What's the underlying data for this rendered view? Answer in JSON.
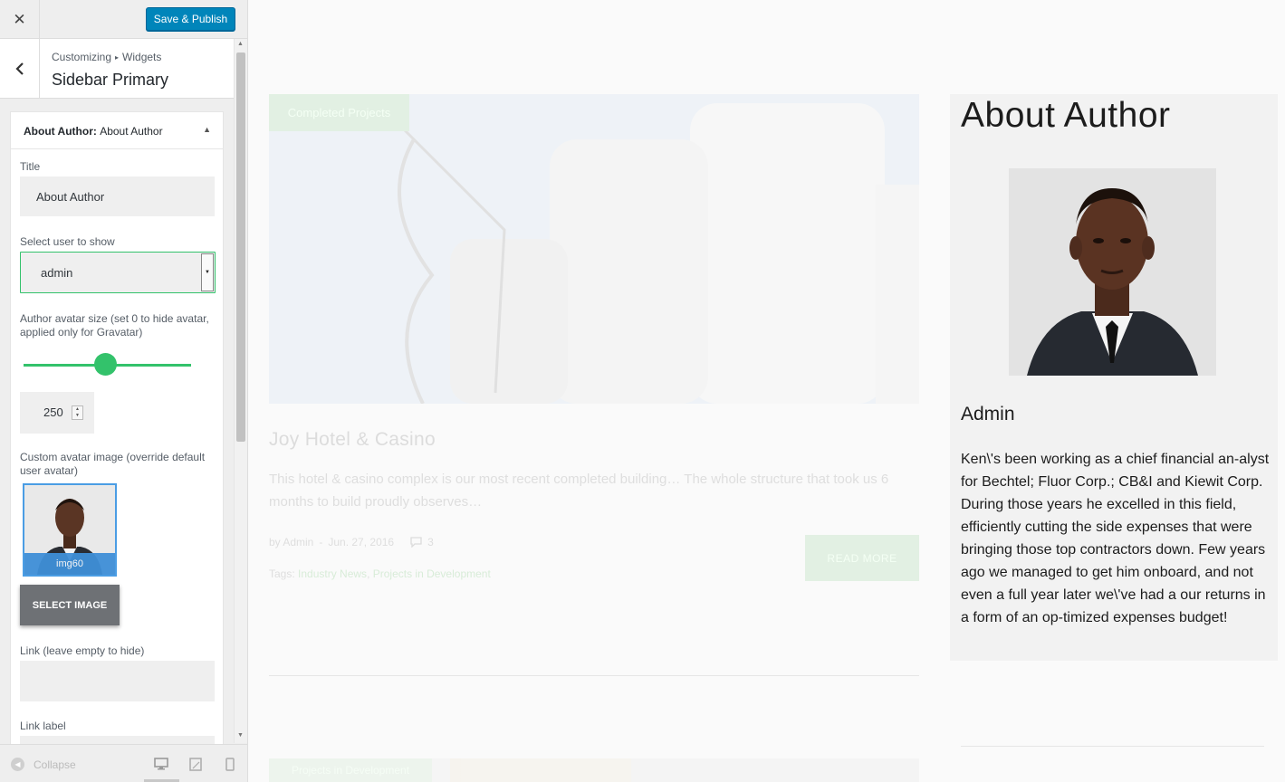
{
  "customizer": {
    "close_icon": "close-icon",
    "publish_label": "Save & Publish",
    "breadcrumb": {
      "root": "Customizing",
      "current": "Widgets"
    },
    "section_title": "Sidebar Primary",
    "widget": {
      "title_prefix": "About Author:",
      "title_name": "About Author",
      "fields": {
        "title_label": "Title",
        "title_value": "About Author",
        "user_label": "Select user to show",
        "user_value": "admin",
        "avatar_size_label": "Author avatar size (set 0 to hide avatar, applied only for Gravatar)",
        "avatar_size_value": "250",
        "avatar_size_slider_fraction": 0.49,
        "custom_avatar_label": "Custom avatar image (override default user avatar)",
        "custom_avatar_filename": "img60",
        "select_image_label": "SELECT IMAGE",
        "link_label": "Link (leave empty to hide)",
        "link_value": "",
        "link_text_label": "Link label"
      }
    },
    "footer": {
      "collapse_label": "Collapse",
      "devices": [
        "desktop-icon",
        "tablet-icon",
        "mobile-icon"
      ],
      "active_device": "desktop"
    },
    "colors": {
      "accent": "#33c26b",
      "publish": "#0085ba"
    }
  },
  "preview": {
    "post": {
      "badge": "Completed Projects",
      "title": "Joy Hotel & Casino",
      "excerpt": "This hotel & casino complex is our most recent completed building… The whole structure that took us 6 months to build proudly observes…",
      "author": "by Admin",
      "date": "Jun. 27, 2016",
      "comments": "3",
      "tags_label": "Tags:",
      "tags": [
        "Industry News",
        "Projects in Development"
      ],
      "read_more": "READ MORE"
    },
    "next_post_badge": "Projects in Development",
    "about": {
      "title": "About Author",
      "name": "Admin",
      "bio": "Ken\\'s been working as a chief financial an-alyst for Bechtel; Fluor Corp.; CB&I and Kiewit Corp. During those years he excelled in this field, efficiently cutting the side expenses that were bringing those top contractors down. Few years ago we managed to get him onboard, and not even a full year later we\\'ve had a our returns in a form of an op-timized expenses budget!"
    }
  }
}
